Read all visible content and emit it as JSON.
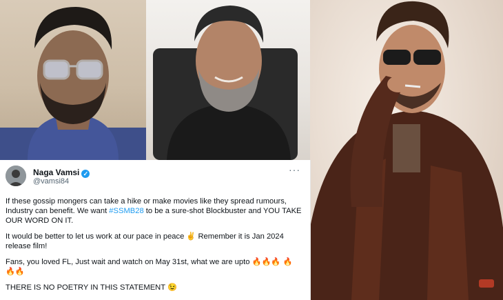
{
  "tweet": {
    "author_name": "Naga Vamsi",
    "handle": "@vamsi84",
    "more_glyph": "···",
    "verified_glyph": "✓",
    "p1_before": "If these gossip mongers can take a hike or make movies like they spread rumours, Industry can benefit. We want ",
    "p1_hashtag": "#SSMB28",
    "p1_after": " to be a sure-shot Blockbuster and YOU TAKE OUR WORD ON IT.",
    "p2_text": "It would be better to let us work at our pace in peace ✌️ Remember it is Jan 2024 release film!",
    "p3_text": "Fans, you loved FL, Just wait and watch on May 31st, what we are upto 🔥🔥🔥 🔥 🔥🔥",
    "p4_text": "THERE IS NO POETRY IN THIS STATEMENT 😉"
  },
  "colors": {
    "link": "#1d9bf0",
    "verified": "#1d9bf0",
    "text": "#0f1419",
    "muted": "#536471"
  }
}
